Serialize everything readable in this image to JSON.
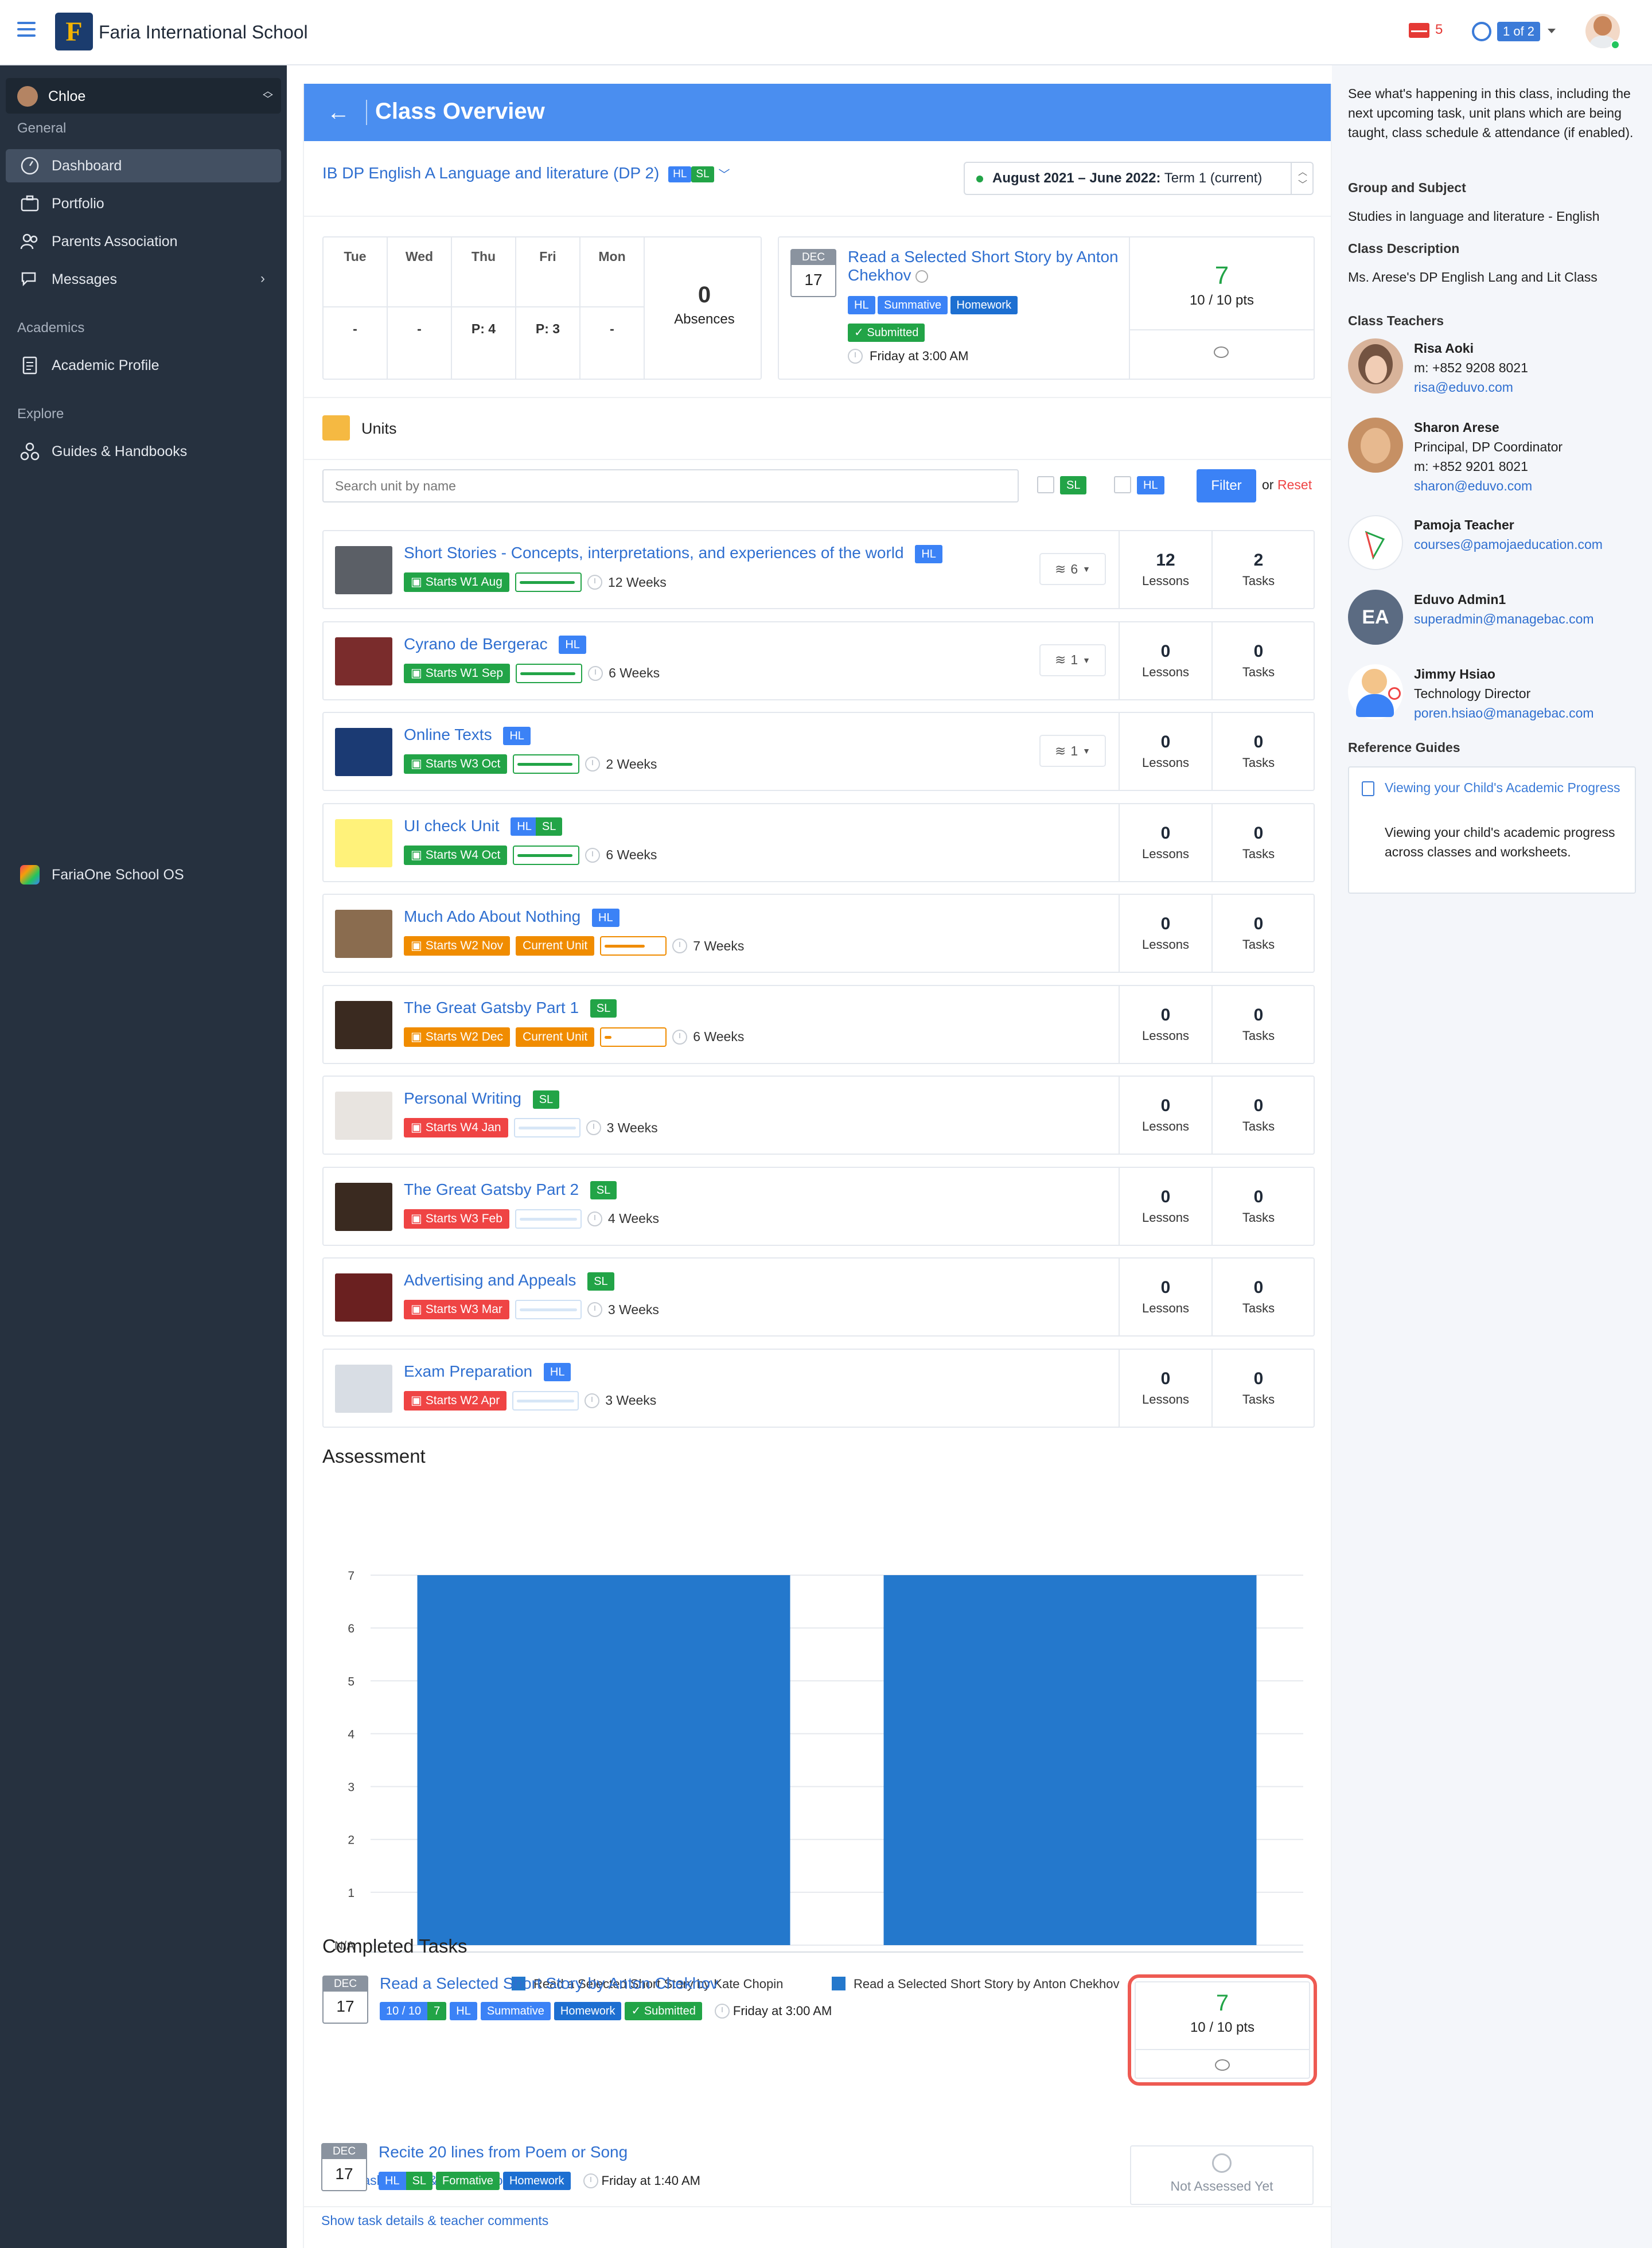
{
  "topbar": {
    "school_name": "Faria International School",
    "mail_count": "5",
    "pager": "1 of 2"
  },
  "sidebar": {
    "user": "Chloe",
    "general_head": "General",
    "items_general": [
      "Dashboard",
      "Portfolio",
      "Parents Association",
      "Messages"
    ],
    "academics_head": "Academics",
    "items_academics": [
      "Academic Profile"
    ],
    "explore_head": "Explore",
    "items_explore": [
      "Guides & Handbooks"
    ],
    "faria_one": "FariaOne School OS"
  },
  "header": {
    "title": "Class Overview",
    "class_name": "IB DP English A Language and literature (DP 2)",
    "term": "August 2021 – June 2022:",
    "term_suffix": "Term 1 (current)"
  },
  "attendance": {
    "days": [
      "Tue",
      "Wed",
      "Thu",
      "Fri",
      "Mon"
    ],
    "values": [
      "-",
      "-",
      "P: 4",
      "P: 3",
      "-"
    ],
    "absences_count": "0",
    "absences_label": "Absences"
  },
  "upcoming": {
    "month": "DEC",
    "day": "17",
    "title": "Read a Selected Short Story by Anton Chekhov",
    "tags": [
      "HL",
      "Summative",
      "Homework"
    ],
    "status": "Submitted",
    "due": "Friday at 3:00 AM",
    "score": "7",
    "points": "10 / 10 pts"
  },
  "units": {
    "title": "Units",
    "search_placeholder": "Search unit by name",
    "filter_sl": "SL",
    "filter_hl": "HL",
    "filter_button": "Filter",
    "or_text": "or",
    "reset": "Reset",
    "lessons_label": "Lessons",
    "tasks_label": "Tasks",
    "list": [
      {
        "name": "Short Stories - Concepts, interpretations, and experiences of the world",
        "tags": [
          "HL"
        ],
        "starts": "Starts W1 Aug",
        "weeks": "12 Weeks",
        "lessons": "12",
        "tasks": "2",
        "dd": "6"
      },
      {
        "name": "Cyrano de Bergerac",
        "tags": [
          "HL"
        ],
        "starts": "Starts W1 Sep",
        "weeks": "6 Weeks",
        "lessons": "0",
        "tasks": "0",
        "dd": "1"
      },
      {
        "name": "Online Texts",
        "tags": [
          "HL"
        ],
        "starts": "Starts W3 Oct",
        "weeks": "2 Weeks",
        "lessons": "0",
        "tasks": "0",
        "dd": "1"
      },
      {
        "name": "UI check Unit",
        "tags": [
          "HL",
          "SL"
        ],
        "starts": "Starts W4 Oct",
        "weeks": "6 Weeks",
        "lessons": "0",
        "tasks": "0"
      },
      {
        "name": "Much Ado About Nothing",
        "tags": [
          "HL"
        ],
        "starts": "Starts W2 Nov",
        "current": "Current Unit",
        "weeks": "7 Weeks",
        "lessons": "0",
        "tasks": "0"
      },
      {
        "name": "The Great Gatsby Part 1",
        "tags": [
          "SL"
        ],
        "starts": "Starts W2 Dec",
        "current": "Current Unit",
        "weeks": "6 Weeks",
        "lessons": "0",
        "tasks": "0"
      },
      {
        "name": "Personal Writing",
        "tags": [
          "SL"
        ],
        "starts": "Starts W4 Jan",
        "weeks": "3 Weeks",
        "lessons": "0",
        "tasks": "0"
      },
      {
        "name": "The Great Gatsby Part 2",
        "tags": [
          "SL"
        ],
        "starts": "Starts W3 Feb",
        "weeks": "4 Weeks",
        "lessons": "0",
        "tasks": "0"
      },
      {
        "name": "Advertising and Appeals",
        "tags": [
          "SL"
        ],
        "starts": "Starts W3 Mar",
        "weeks": "3 Weeks",
        "lessons": "0",
        "tasks": "0"
      },
      {
        "name": "Exam Preparation",
        "tags": [
          "HL"
        ],
        "starts": "Starts W2 Apr",
        "weeks": "3 Weeks",
        "lessons": "0",
        "tasks": "0"
      }
    ]
  },
  "assessment": {
    "title": "Assessment"
  },
  "chart_data": {
    "type": "bar",
    "categories": [
      "Read a Selected Short Story by Kate Chopin",
      "Read a Selected Short Story by Anton Chekhov"
    ],
    "values": [
      7,
      7
    ],
    "y_ticks": [
      "N/A",
      "1",
      "2",
      "3",
      "4",
      "5",
      "6",
      "7"
    ],
    "ylim": [
      0,
      7
    ],
    "legend_position": "bottom",
    "color": "#2478cc"
  },
  "completed": {
    "title": "Completed Tasks",
    "show_details": "Show task details & teacher comments",
    "tasks": [
      {
        "month": "DEC",
        "day": "17",
        "title": "Read a Selected Short Story by Anton Chekhov",
        "grade_frac": "10 / 10",
        "grade": "7",
        "tags": [
          "HL",
          "Summative",
          "Homework"
        ],
        "status": "Submitted",
        "due": "Friday at 3:00 AM",
        "score": "7",
        "points": "10 / 10 pts"
      },
      {
        "month": "DEC",
        "day": "17",
        "title": "Recite 20 lines from Poem or Song",
        "tags": [
          "HL",
          "SL",
          "Formative",
          "Homework"
        ],
        "due": "Friday at 1:40 AM",
        "not_assessed": "Not Assessed Yet"
      }
    ]
  },
  "right": {
    "intro": "See what's happening in this class, including the next upcoming task, unit plans which are being taught, class schedule & attendance (if enabled).",
    "group_head": "Group and Subject",
    "group": "Studies in language and literature - English",
    "desc_head": "Class Description",
    "desc": "Ms. Arese's DP English Lang and Lit Class",
    "teachers_head": "Class Teachers",
    "teachers": [
      {
        "name": "Risa Aoki",
        "line1": "m: +852 9208 8021",
        "email": "risa@eduvo.com"
      },
      {
        "name": "Sharon Arese",
        "line1": "Principal, DP Coordinator",
        "line2": "m: +852 9201 8021",
        "email": "sharon@eduvo.com"
      },
      {
        "name": "Pamoja Teacher",
        "email": "courses@pamojaeducation.com"
      },
      {
        "name": "Eduvo Admin1",
        "email": "superadmin@managebac.com",
        "initials": "EA"
      },
      {
        "name": "Jimmy Hsiao",
        "line1": "Technology Director",
        "email": "poren.hsiao@managebac.com"
      }
    ],
    "ref_head": "Reference Guides",
    "ref_title": "Viewing your Child's Academic Progress",
    "ref_desc": "Viewing your child's academic progress across classes and worksheets."
  }
}
